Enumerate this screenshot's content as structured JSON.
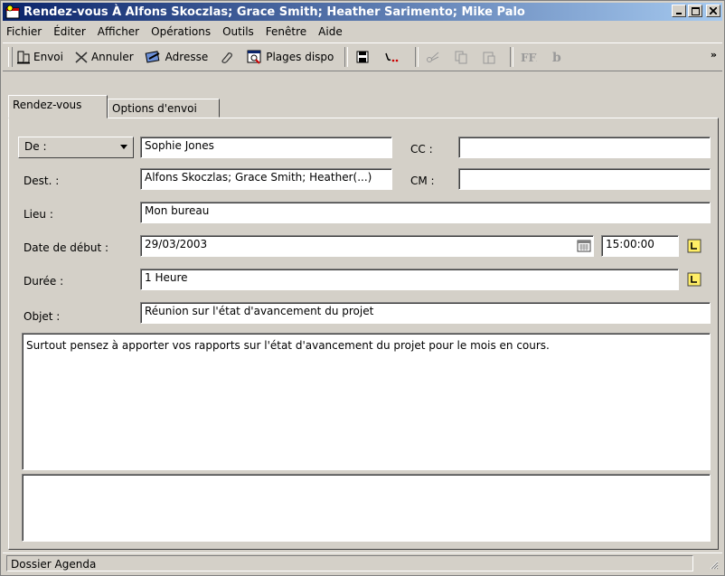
{
  "window": {
    "title": "Rendez-vous À Alfons Skoczlas; Grace Smith; Heather Sarimento; Mike Palo"
  },
  "menu": [
    "Fichier",
    "Éditer",
    "Afficher",
    "Opérations",
    "Outils",
    "Fenêtre",
    "Aide"
  ],
  "toolbar": {
    "send_label": "Envoi",
    "cancel_label": "Annuler",
    "address_label": "Adresse",
    "availability_label": "Plages dispo",
    "overflow": "»"
  },
  "tabs": {
    "appointment": "Rendez-vous",
    "send_options": "Options d'envoi"
  },
  "form": {
    "from_label": "De :",
    "from_value": "Sophie Jones",
    "cc_label": "CC :",
    "cc_value": "",
    "to_label": "Dest. :",
    "to_value": "Alfons Skoczlas; Grace Smith; Heather(...)",
    "bcc_label": "CM :",
    "bcc_value": "",
    "location_label": "Lieu :",
    "location_value": "Mon bureau",
    "start_label": "Date de début :",
    "start_date": "29/03/2003",
    "start_time": "15:00:00",
    "duration_label": "Durée :",
    "duration_value": "1 Heure",
    "subject_label": "Objet :",
    "subject_value": "Réunion sur l'état d'avancement du projet",
    "message": "Surtout pensez à apporter vos rapports sur l'état d'avancement du projet pour le mois en cours.",
    "notes": ""
  },
  "status": {
    "folder": "Dossier Agenda"
  },
  "colors": {
    "titlebar_start": "#0a246a",
    "titlebar_end": "#a6caf0",
    "face": "#d4d0c8"
  },
  "icons": [
    "app-icon",
    "send-icon",
    "cancel-icon",
    "address-book-icon",
    "attach-icon",
    "availability-icon",
    "save-icon",
    "signature-icon",
    "cut-icon",
    "copy-icon",
    "paste-icon",
    "font-icon",
    "bold-icon",
    "calendar-icon",
    "clock-icon"
  ]
}
